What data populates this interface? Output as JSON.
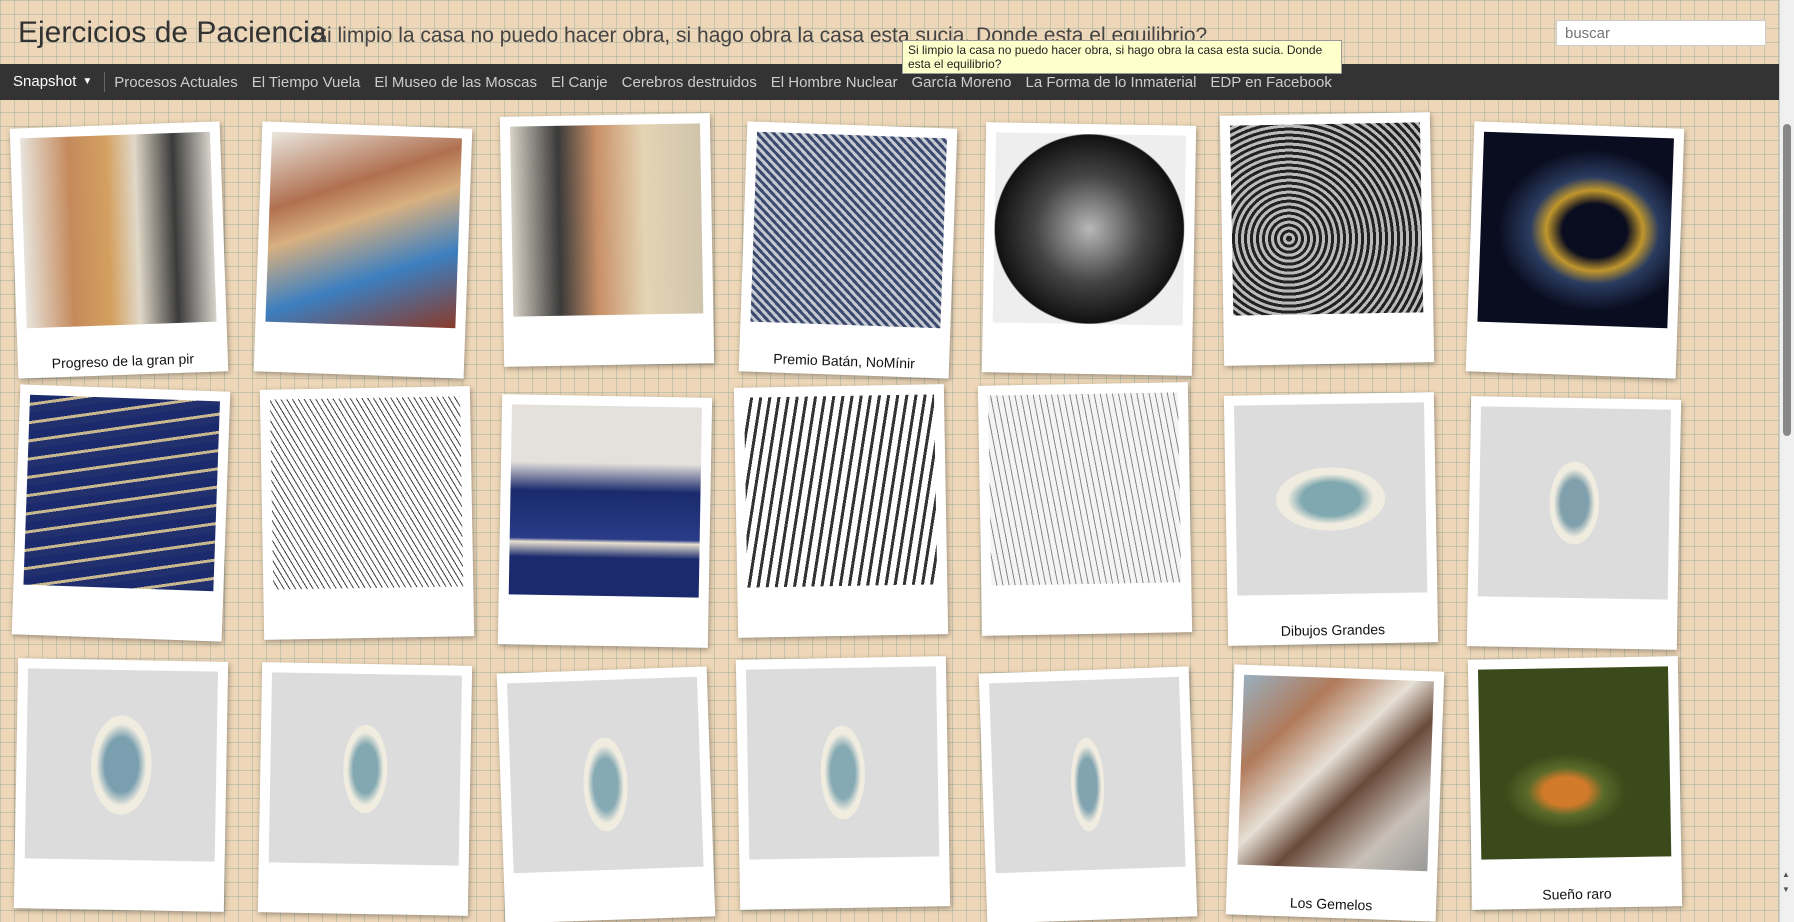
{
  "header": {
    "title": "Ejercicios de Paciencia",
    "description": "Si limpio la casa no puedo hacer obra, si hago obra la casa esta sucia. Donde esta el equilibrio?",
    "search_placeholder": "buscar",
    "tooltip": "Si limpio la casa no puedo hacer obra, si hago obra la casa esta sucia. Donde esta el equilibrio?"
  },
  "nav": {
    "snapshot_label": "Snapshot",
    "items": [
      "Procesos Actuales",
      "El Tiempo Vuela",
      "El Museo de las Moscas",
      "El Canje",
      "Cerebros destruidos",
      "El Hombre Nuclear",
      "García Moreno",
      "La Forma de lo Inmaterial",
      "EDP en Facebook"
    ]
  },
  "tiles": [
    {
      "caption": "Progreso de la gran pir",
      "photo": "mural-centaur-tiger-artist"
    },
    {
      "caption": "",
      "photo": "mural-centaur-peacock"
    },
    {
      "caption": "",
      "photo": "artist-with-mural"
    },
    {
      "caption": "Premio Batán, NoMínir",
      "photo": "artist-drawing-floor"
    },
    {
      "caption": "",
      "photo": "black-white-tree-drawing"
    },
    {
      "caption": "",
      "photo": "white-lines-tree-drawing"
    },
    {
      "caption": "",
      "photo": "golden-lines-face"
    },
    {
      "caption": "",
      "photo": "blue-drawing-marker"
    },
    {
      "caption": "",
      "photo": "line-drawing-plant"
    },
    {
      "caption": "",
      "photo": "artist-blue-floor"
    },
    {
      "caption": "",
      "photo": "black-maze-lines"
    },
    {
      "caption": "",
      "photo": "pencil-landscape-figures"
    },
    {
      "caption": "Dibujos Grandes",
      "photo": "framed-blue-horizontal"
    },
    {
      "caption": "",
      "photo": "framed-blue-vertical"
    },
    {
      "caption": "",
      "photo": "framed-blue-cluster"
    },
    {
      "caption": "",
      "photo": "framed-blue-small"
    },
    {
      "caption": "",
      "photo": "framed-blue-column"
    },
    {
      "caption": "",
      "photo": "framed-blue-shape"
    },
    {
      "caption": "",
      "photo": "framed-blue-narrow"
    },
    {
      "caption": "Los Gemelos",
      "photo": "painted-mural-people"
    },
    {
      "caption": "Sueño raro",
      "photo": "cat-in-garden"
    }
  ],
  "colors": {
    "background": "#eed7b8",
    "navbar": "#333333",
    "tooltip": "#ffffcc"
  }
}
